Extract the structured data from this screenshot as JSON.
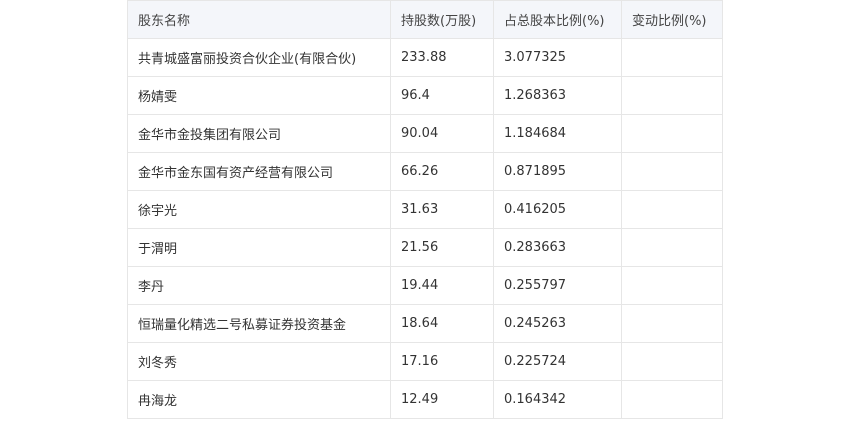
{
  "table": {
    "headers": [
      "股东名称",
      "持股数(万股)",
      "占总股本比例(%)",
      "变动比例(%)"
    ],
    "rows": [
      [
        "共青城盛富丽投资合伙企业(有限合伙)",
        "233.88",
        "3.077325",
        ""
      ],
      [
        "杨婧雯",
        "96.4",
        "1.268363",
        ""
      ],
      [
        "金华市金投集团有限公司",
        "90.04",
        "1.184684",
        ""
      ],
      [
        "金华市金东国有资产经营有限公司",
        "66.26",
        "0.871895",
        ""
      ],
      [
        "徐宇光",
        "31.63",
        "0.416205",
        ""
      ],
      [
        "于渭明",
        "21.56",
        "0.283663",
        ""
      ],
      [
        "李丹",
        "19.44",
        "0.255797",
        ""
      ],
      [
        "恒瑞量化精选二号私募证券投资基金",
        "18.64",
        "0.245263",
        ""
      ],
      [
        "刘冬秀",
        "17.16",
        "0.225724",
        ""
      ],
      [
        "冉海龙",
        "12.49",
        "0.164342",
        ""
      ]
    ]
  }
}
